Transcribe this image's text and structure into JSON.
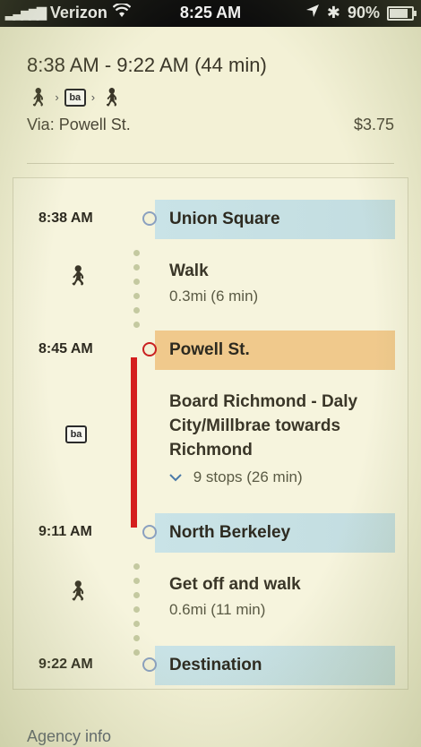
{
  "status_bar": {
    "carrier": "Verizon",
    "time": "8:25 AM",
    "battery": "90%",
    "battery_level": 0.9
  },
  "summary": {
    "time_range": "8:38 AM - 9:22 AM (44 min)",
    "bart_label": "ba",
    "via": "Via: Powell St.",
    "fare": "$3.75"
  },
  "itinerary": {
    "stops": [
      {
        "time": "8:38 AM",
        "name": "Union Square"
      },
      {
        "time": "8:45 AM",
        "name": "Powell St."
      },
      {
        "time": "9:11 AM",
        "name": "North Berkeley"
      },
      {
        "time": "9:22 AM",
        "name": "Destination"
      }
    ],
    "legs": [
      {
        "title": "Walk",
        "detail": "0.3mi (6 min)"
      },
      {
        "title": "Board Richmond - Daly City/Millbrae towards Richmond",
        "detail": "9 stops (26 min)"
      },
      {
        "title": "Get off and walk",
        "detail": "0.6mi (11 min)"
      }
    ]
  },
  "footer": {
    "agency_link": "Agency info"
  },
  "colors": {
    "stop_band_blue": "#c9e3e7",
    "stop_band_orange": "#f0c98c",
    "transit_line": "#d41e1e",
    "walk_dots": "#c4c9a0"
  }
}
